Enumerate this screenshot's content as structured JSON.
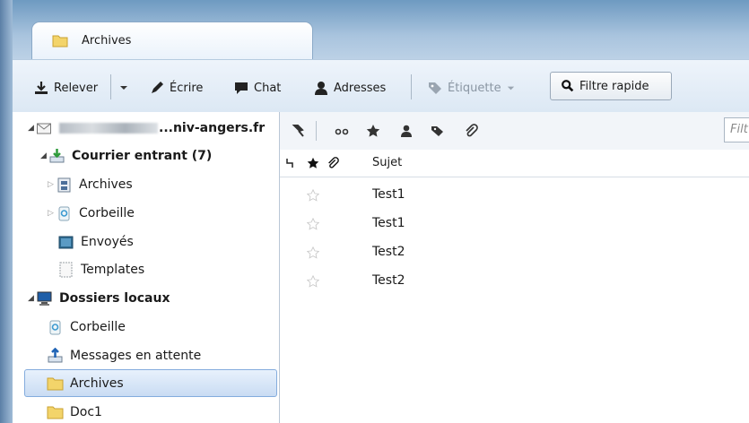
{
  "window": {
    "tab": {
      "label": "Archives"
    }
  },
  "toolbar": {
    "get_messages": "Relever",
    "write": "Écrire",
    "chat": "Chat",
    "address_book": "Adresses",
    "tag": "Étiquette",
    "quick_filter": "Filtre rapide"
  },
  "folders": {
    "account_name": "...niv-angers.fr",
    "inbox": "Courrier entrant (7)",
    "archives_sub": "Archives",
    "trash_sub": "Corbeille",
    "sent": "Envoyés",
    "templates": "Templates",
    "local_folders": "Dossiers locaux",
    "local_trash": "Corbeille",
    "outbox": "Messages en attente",
    "local_archives": "Archives",
    "doc1": "Doc1"
  },
  "filter": {
    "placeholder": "Filt"
  },
  "message_list": {
    "columns": {
      "subject": "Sujet"
    },
    "rows": [
      {
        "subject": "Test1"
      },
      {
        "subject": "Test1"
      },
      {
        "subject": "Test2"
      },
      {
        "subject": "Test2"
      }
    ]
  },
  "colors": {
    "selection": "#c9dcf3",
    "accent": "#2f6fb6"
  }
}
